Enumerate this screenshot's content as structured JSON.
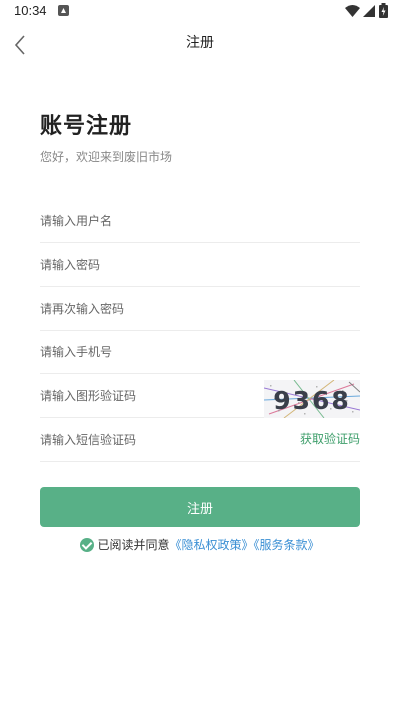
{
  "status_bar": {
    "time": "10:34"
  },
  "nav": {
    "title": "注册"
  },
  "header": {
    "title": "账号注册",
    "subtitle": "您好，欢迎来到废旧市场"
  },
  "form": {
    "username_placeholder": "请输入用户名",
    "password_placeholder": "请输入密码",
    "password_confirm_placeholder": "请再次输入密码",
    "phone_placeholder": "请输入手机号",
    "captcha_placeholder": "请输入图形验证码",
    "captcha_text": "9368",
    "sms_placeholder": "请输入短信验证码",
    "sms_button": "获取验证码"
  },
  "register_button": "注册",
  "agreement": {
    "prefix": "已阅读并同意",
    "privacy_policy": "《隐私权政策》",
    "terms_of_service": "《服务条款》"
  },
  "colors": {
    "accent": "#58b087",
    "link": "#3a8fd4"
  }
}
